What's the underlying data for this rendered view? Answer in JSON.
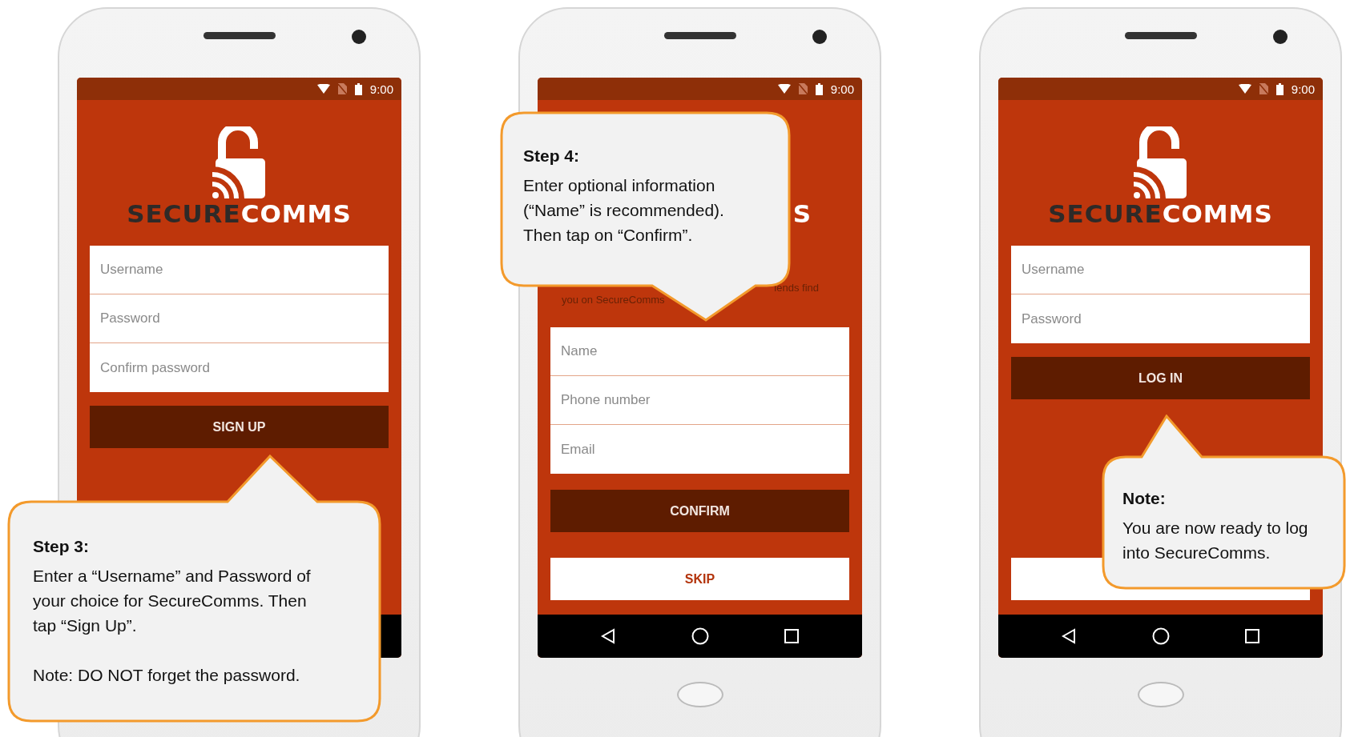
{
  "phones": [
    {
      "status": {
        "time": "9:00"
      },
      "wordmark": [
        {
          "text": "SECURE",
          "color": "#2e2a28"
        },
        {
          "text": "COMMS",
          "color": "#ffffff"
        }
      ],
      "fields": [
        {
          "placeholder": "Username"
        },
        {
          "placeholder": "Password"
        },
        {
          "placeholder": "Confirm password"
        }
      ],
      "buttons": [
        {
          "label": "SIGN UP",
          "kind": "primary"
        }
      ]
    },
    {
      "status": {
        "time": "9:00"
      },
      "logo_fragment": "S",
      "intro_fragments": [
        "iends find",
        "you on SecureComms"
      ],
      "fields": [
        {
          "placeholder": "Name"
        },
        {
          "placeholder": "Phone number"
        },
        {
          "placeholder": "Email"
        }
      ],
      "buttons": [
        {
          "label": "CONFIRM",
          "kind": "primary"
        },
        {
          "label": "SKIP",
          "kind": "secondary"
        }
      ],
      "nav": [
        {
          "kind": "back"
        },
        {
          "kind": "home"
        },
        {
          "kind": "recent"
        }
      ]
    },
    {
      "status": {
        "time": "9:00"
      },
      "wordmark": [
        {
          "text": "SECURE",
          "color": "#2e2a28"
        },
        {
          "text": "COMMS",
          "color": "#ffffff"
        }
      ],
      "fields": [
        {
          "placeholder": "Username"
        },
        {
          "placeholder": "Password"
        }
      ],
      "buttons": [
        {
          "label": "LOG IN",
          "kind": "primary"
        },
        {
          "kind": "secondary"
        }
      ],
      "nav": [
        {
          "kind": "back"
        },
        {
          "kind": "home"
        },
        {
          "kind": "recent"
        }
      ]
    }
  ],
  "callouts": [
    {
      "title": "Step 3:",
      "paragraphs": [
        "Enter a “Username” and Password of your choice for SecureComms. Then tap “Sign Up”.",
        "Note: DO NOT forget the password."
      ]
    },
    {
      "title": "Step 4:",
      "paragraphs": [
        "Enter optional information (“Name” is recommended). Then tap on “Confirm”."
      ]
    },
    {
      "title": "Note:",
      "paragraphs": [
        "You are now ready to log into SecureComms."
      ]
    }
  ]
}
